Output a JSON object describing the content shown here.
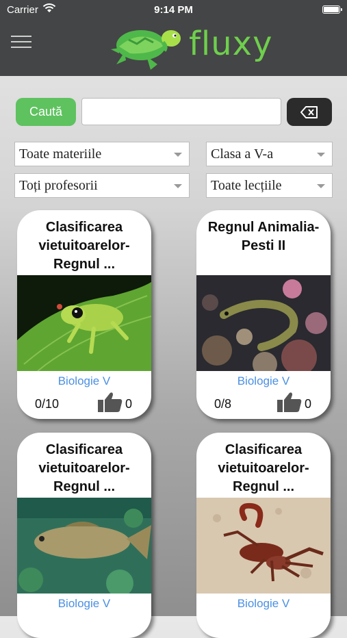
{
  "status": {
    "carrier": "Carrier",
    "time": "9:14 PM"
  },
  "header": {
    "brand": "fluxy"
  },
  "search": {
    "button_label": "Caută",
    "value": ""
  },
  "filters": {
    "subject": "Toate materiile",
    "grade": "Clasa a V-a",
    "teacher": "Toți profesorii",
    "lesson": "Toate lecțiile"
  },
  "cards": [
    {
      "title": "Clasificarea vietuitoarelor-Regnul ...",
      "subject": "Biologie V",
      "progress": "0/10",
      "likes": "0",
      "image": "frog-photo"
    },
    {
      "title": "Regnul Animalia-Pesti II",
      "subject": "Biologie V",
      "progress": "0/8",
      "likes": "0",
      "image": "eel-photo"
    },
    {
      "title": "Clasificarea vietuitoarelor-Regnul ...",
      "subject": "Biologie V",
      "progress": "",
      "likes": "",
      "image": "carp-photo"
    },
    {
      "title": "Clasificarea vietuitoarelor-Regnul ...",
      "subject": "Biologie V",
      "progress": "",
      "likes": "",
      "image": "scorpion-photo"
    }
  ],
  "colors": {
    "accent_green": "#5ec25f",
    "link_blue": "#4a90e2",
    "header_bg": "#444546"
  }
}
